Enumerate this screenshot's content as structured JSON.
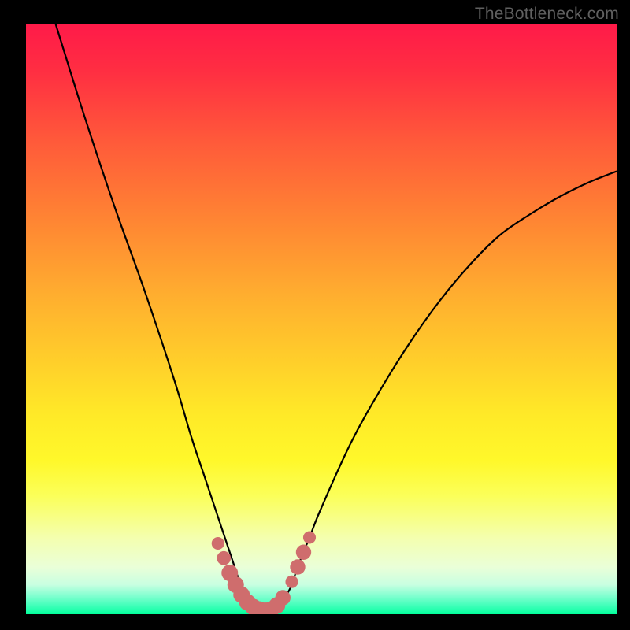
{
  "watermark": "TheBottleneck.com",
  "colors": {
    "background": "#000000",
    "curve_stroke": "#000000",
    "marker_fill": "#cf6d6d",
    "gradient_top": "#ff1a49",
    "gradient_bottom": "#00ff99"
  },
  "chart_data": {
    "type": "line",
    "title": "",
    "xlabel": "",
    "ylabel": "",
    "xlim": [
      0,
      100
    ],
    "ylim": [
      0,
      100
    ],
    "grid": false,
    "series": [
      {
        "name": "bottleneck-curve",
        "x": [
          5,
          10,
          15,
          20,
          25,
          28,
          30,
          32,
          34,
          35,
          36,
          37,
          38,
          39,
          40,
          41,
          42,
          43,
          44,
          45,
          46,
          48,
          50,
          55,
          60,
          65,
          70,
          75,
          80,
          85,
          90,
          95,
          100
        ],
        "values": [
          100,
          84,
          69,
          55,
          40,
          30,
          24,
          18,
          12,
          9,
          6,
          4,
          2,
          1,
          0.5,
          0.5,
          0.5,
          1,
          3,
          5,
          8,
          13,
          18,
          29,
          38,
          46,
          53,
          59,
          64,
          67.5,
          70.5,
          73,
          75
        ]
      }
    ],
    "markers": [
      {
        "x": 32.5,
        "y": 12,
        "r": 1.1
      },
      {
        "x": 33.5,
        "y": 9.5,
        "r": 1.3
      },
      {
        "x": 34.5,
        "y": 7.0,
        "r": 1.7
      },
      {
        "x": 35.5,
        "y": 5.0,
        "r": 1.7
      },
      {
        "x": 36.5,
        "y": 3.3,
        "r": 1.7
      },
      {
        "x": 37.5,
        "y": 2.0,
        "r": 1.7
      },
      {
        "x": 38.5,
        "y": 1.2,
        "r": 1.7
      },
      {
        "x": 39.5,
        "y": 0.8,
        "r": 1.7
      },
      {
        "x": 40.5,
        "y": 0.6,
        "r": 1.7
      },
      {
        "x": 41.5,
        "y": 0.8,
        "r": 1.7
      },
      {
        "x": 42.5,
        "y": 1.5,
        "r": 1.7
      },
      {
        "x": 43.5,
        "y": 2.8,
        "r": 1.5
      },
      {
        "x": 45.0,
        "y": 5.5,
        "r": 1.1
      },
      {
        "x": 46.0,
        "y": 8.0,
        "r": 1.5
      },
      {
        "x": 47.0,
        "y": 10.5,
        "r": 1.5
      },
      {
        "x": 48.0,
        "y": 13.0,
        "r": 1.1
      }
    ],
    "annotations": []
  }
}
